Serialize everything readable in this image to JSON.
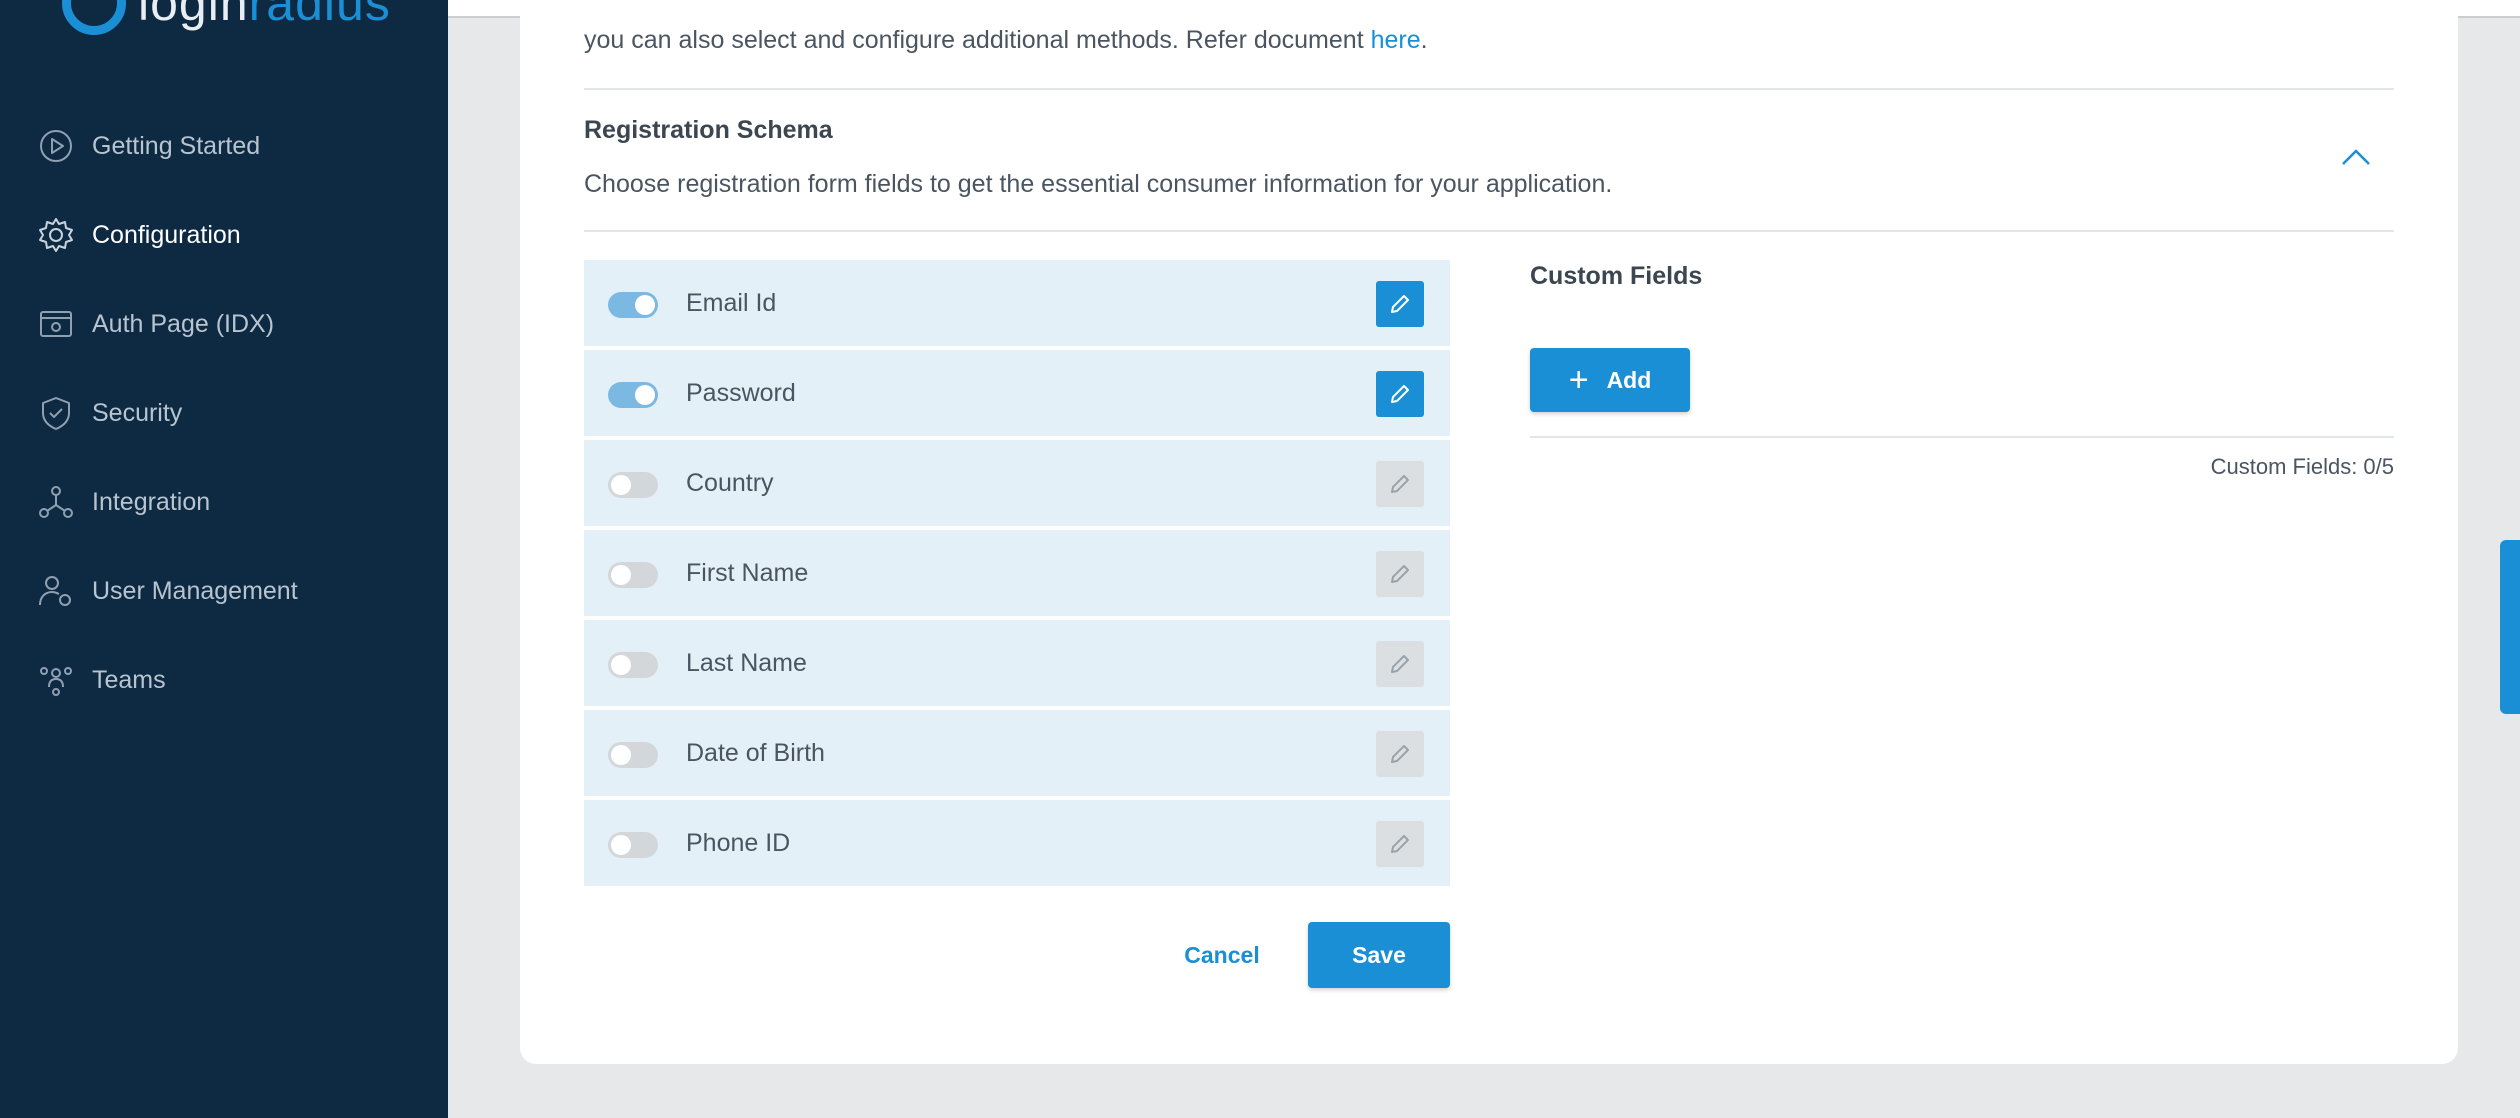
{
  "brand": {
    "logo_text_a": "login",
    "logo_text_b": "radius",
    "accent_color": "#1b8fd6",
    "sidebar_bg": "#0d2a42"
  },
  "sidebar": {
    "items": [
      {
        "label": "Getting Started",
        "icon": "play-circle-icon",
        "active": false
      },
      {
        "label": "Configuration",
        "icon": "gear-icon",
        "active": true
      },
      {
        "label": "Auth Page (IDX)",
        "icon": "browser-window-icon",
        "active": false
      },
      {
        "label": "Security",
        "icon": "shield-icon",
        "active": false
      },
      {
        "label": "Integration",
        "icon": "network-icon",
        "active": false
      },
      {
        "label": "User Management",
        "icon": "user-gear-icon",
        "active": false
      },
      {
        "label": "Teams",
        "icon": "team-icon",
        "active": false
      }
    ]
  },
  "intro": {
    "text": "you can also select and configure additional methods. Refer document ",
    "link": "here",
    "suffix": "."
  },
  "registration_schema": {
    "title": "Registration Schema",
    "description": "Choose registration form fields to get the essential consumer information for your application.",
    "fields": [
      {
        "label": "Email Id",
        "enabled": true
      },
      {
        "label": "Password",
        "enabled": true
      },
      {
        "label": "Country",
        "enabled": false
      },
      {
        "label": "First Name",
        "enabled": false
      },
      {
        "label": "Last Name",
        "enabled": false
      },
      {
        "label": "Date of Birth",
        "enabled": false
      },
      {
        "label": "Phone ID",
        "enabled": false
      }
    ]
  },
  "custom_fields": {
    "title": "Custom Fields",
    "add_label": "Add",
    "count_text": "Custom Fields: 0/5"
  },
  "actions": {
    "cancel_label": "Cancel",
    "save_label": "Save"
  }
}
